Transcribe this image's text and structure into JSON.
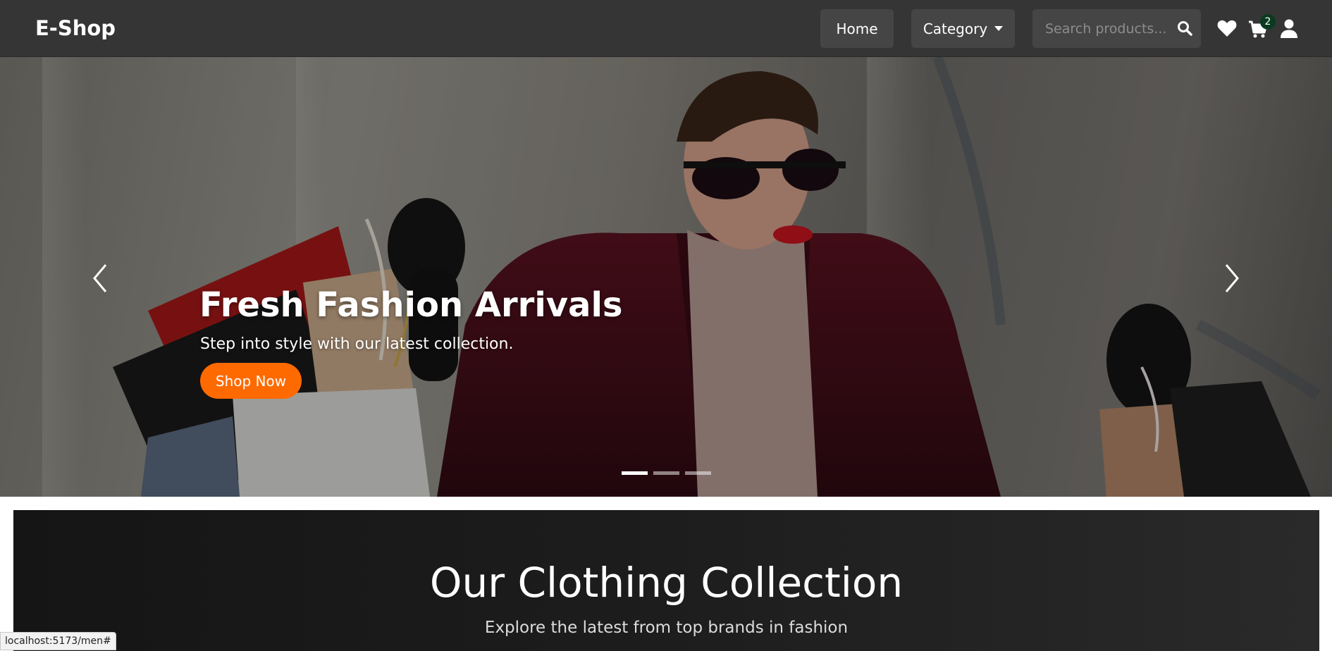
{
  "navbar": {
    "brand": "E-Shop",
    "home_label": "Home",
    "category_label": "Category",
    "search_placeholder": "Search products...",
    "cart_count": "2",
    "icons": [
      "search-icon",
      "heart-icon",
      "cart-icon",
      "user-icon"
    ]
  },
  "hero": {
    "title": "Fresh Fashion Arrivals",
    "subtitle": "Step into style with our latest collection.",
    "cta_label": "Shop Now",
    "active_slide": 1,
    "slide_count": 3
  },
  "collection": {
    "title": "Our Clothing Collection",
    "subtitle": "Explore the latest from top brands in fashion"
  },
  "status_bar": {
    "url": "localhost:5173/men#"
  },
  "colors": {
    "navbar_bg": "#353535",
    "nav_button_bg": "#454545",
    "cta_orange": "#ff6a00",
    "badge_green": "#0a3a1f",
    "banner_dark": "#1d1d1d"
  }
}
